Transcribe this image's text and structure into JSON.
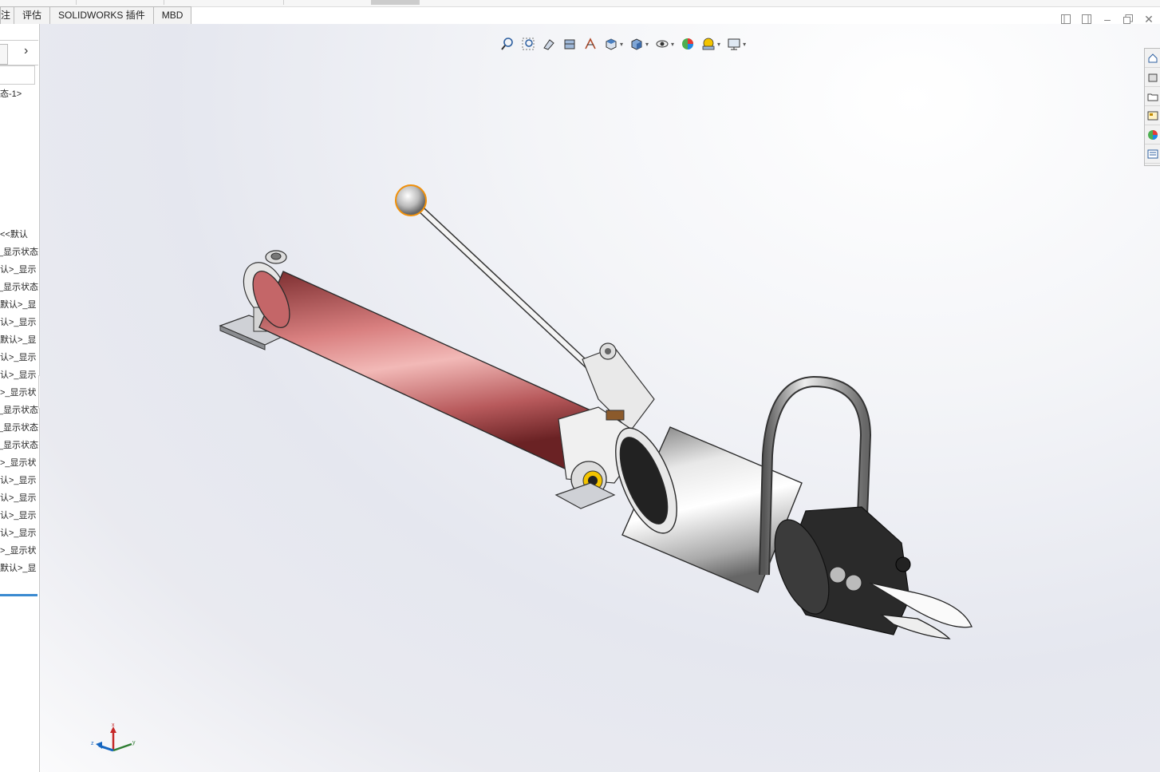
{
  "tabs": [
    {
      "label": "注"
    },
    {
      "label": "评估"
    },
    {
      "label": "SOLIDWORKS 插件"
    },
    {
      "label": "MBD"
    }
  ],
  "tree": {
    "config_label": "态-1>",
    "items": [
      "<<默认",
      "_显示状态",
      "认>_显示",
      "_显示状态",
      "默认>_显",
      "认>_显示",
      "默认>_显",
      "认>_显示",
      "认>_显示",
      ">_显示状",
      "_显示状态",
      "_显示状态",
      "_显示状态",
      ">_显示状",
      "认>_显示",
      "认>_显示",
      "认>_显示",
      "认>_显示",
      ">_显示状",
      "默认>_显"
    ]
  },
  "hud_icons": [
    "zoom-to-fit-icon",
    "zoom-to-area-icon",
    "previous-view-icon",
    "section-view-icon",
    "dynamic-annotation-icon",
    "view-orientation-icon",
    "display-style-icon",
    "hide-show-items-icon",
    "edit-appearance-icon",
    "apply-scene-icon",
    "view-settings-icon"
  ],
  "triad": {
    "x": "x",
    "y": "y",
    "z": "z"
  },
  "colors": {
    "accent": "#3a8ad0",
    "cylinder": "#c9676a",
    "orange_edge": "#f0900a"
  }
}
